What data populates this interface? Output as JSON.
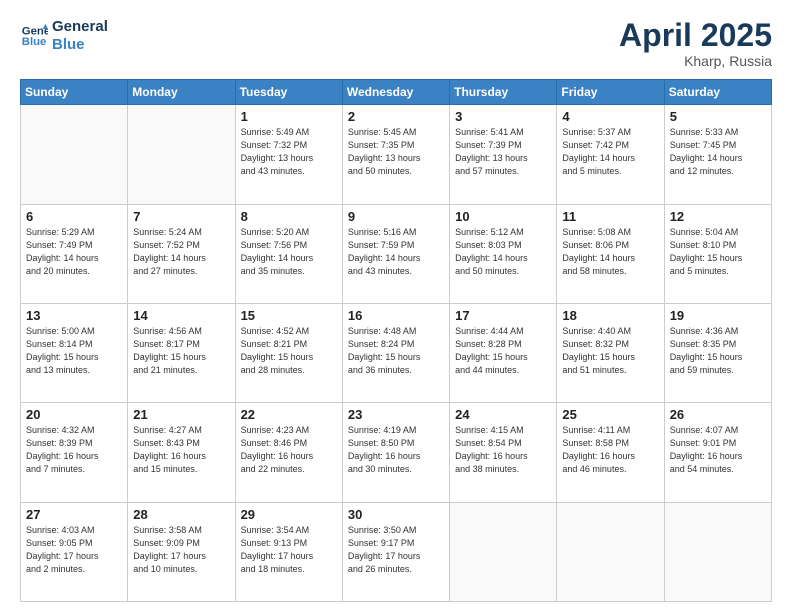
{
  "header": {
    "logo_line1": "General",
    "logo_line2": "Blue",
    "month": "April 2025",
    "location": "Kharp, Russia"
  },
  "weekdays": [
    "Sunday",
    "Monday",
    "Tuesday",
    "Wednesday",
    "Thursday",
    "Friday",
    "Saturday"
  ],
  "weeks": [
    [
      {
        "day": "",
        "info": ""
      },
      {
        "day": "",
        "info": ""
      },
      {
        "day": "1",
        "info": "Sunrise: 5:49 AM\nSunset: 7:32 PM\nDaylight: 13 hours\nand 43 minutes."
      },
      {
        "day": "2",
        "info": "Sunrise: 5:45 AM\nSunset: 7:35 PM\nDaylight: 13 hours\nand 50 minutes."
      },
      {
        "day": "3",
        "info": "Sunrise: 5:41 AM\nSunset: 7:39 PM\nDaylight: 13 hours\nand 57 minutes."
      },
      {
        "day": "4",
        "info": "Sunrise: 5:37 AM\nSunset: 7:42 PM\nDaylight: 14 hours\nand 5 minutes."
      },
      {
        "day": "5",
        "info": "Sunrise: 5:33 AM\nSunset: 7:45 PM\nDaylight: 14 hours\nand 12 minutes."
      }
    ],
    [
      {
        "day": "6",
        "info": "Sunrise: 5:29 AM\nSunset: 7:49 PM\nDaylight: 14 hours\nand 20 minutes."
      },
      {
        "day": "7",
        "info": "Sunrise: 5:24 AM\nSunset: 7:52 PM\nDaylight: 14 hours\nand 27 minutes."
      },
      {
        "day": "8",
        "info": "Sunrise: 5:20 AM\nSunset: 7:56 PM\nDaylight: 14 hours\nand 35 minutes."
      },
      {
        "day": "9",
        "info": "Sunrise: 5:16 AM\nSunset: 7:59 PM\nDaylight: 14 hours\nand 43 minutes."
      },
      {
        "day": "10",
        "info": "Sunrise: 5:12 AM\nSunset: 8:03 PM\nDaylight: 14 hours\nand 50 minutes."
      },
      {
        "day": "11",
        "info": "Sunrise: 5:08 AM\nSunset: 8:06 PM\nDaylight: 14 hours\nand 58 minutes."
      },
      {
        "day": "12",
        "info": "Sunrise: 5:04 AM\nSunset: 8:10 PM\nDaylight: 15 hours\nand 5 minutes."
      }
    ],
    [
      {
        "day": "13",
        "info": "Sunrise: 5:00 AM\nSunset: 8:14 PM\nDaylight: 15 hours\nand 13 minutes."
      },
      {
        "day": "14",
        "info": "Sunrise: 4:56 AM\nSunset: 8:17 PM\nDaylight: 15 hours\nand 21 minutes."
      },
      {
        "day": "15",
        "info": "Sunrise: 4:52 AM\nSunset: 8:21 PM\nDaylight: 15 hours\nand 28 minutes."
      },
      {
        "day": "16",
        "info": "Sunrise: 4:48 AM\nSunset: 8:24 PM\nDaylight: 15 hours\nand 36 minutes."
      },
      {
        "day": "17",
        "info": "Sunrise: 4:44 AM\nSunset: 8:28 PM\nDaylight: 15 hours\nand 44 minutes."
      },
      {
        "day": "18",
        "info": "Sunrise: 4:40 AM\nSunset: 8:32 PM\nDaylight: 15 hours\nand 51 minutes."
      },
      {
        "day": "19",
        "info": "Sunrise: 4:36 AM\nSunset: 8:35 PM\nDaylight: 15 hours\nand 59 minutes."
      }
    ],
    [
      {
        "day": "20",
        "info": "Sunrise: 4:32 AM\nSunset: 8:39 PM\nDaylight: 16 hours\nand 7 minutes."
      },
      {
        "day": "21",
        "info": "Sunrise: 4:27 AM\nSunset: 8:43 PM\nDaylight: 16 hours\nand 15 minutes."
      },
      {
        "day": "22",
        "info": "Sunrise: 4:23 AM\nSunset: 8:46 PM\nDaylight: 16 hours\nand 22 minutes."
      },
      {
        "day": "23",
        "info": "Sunrise: 4:19 AM\nSunset: 8:50 PM\nDaylight: 16 hours\nand 30 minutes."
      },
      {
        "day": "24",
        "info": "Sunrise: 4:15 AM\nSunset: 8:54 PM\nDaylight: 16 hours\nand 38 minutes."
      },
      {
        "day": "25",
        "info": "Sunrise: 4:11 AM\nSunset: 8:58 PM\nDaylight: 16 hours\nand 46 minutes."
      },
      {
        "day": "26",
        "info": "Sunrise: 4:07 AM\nSunset: 9:01 PM\nDaylight: 16 hours\nand 54 minutes."
      }
    ],
    [
      {
        "day": "27",
        "info": "Sunrise: 4:03 AM\nSunset: 9:05 PM\nDaylight: 17 hours\nand 2 minutes."
      },
      {
        "day": "28",
        "info": "Sunrise: 3:58 AM\nSunset: 9:09 PM\nDaylight: 17 hours\nand 10 minutes."
      },
      {
        "day": "29",
        "info": "Sunrise: 3:54 AM\nSunset: 9:13 PM\nDaylight: 17 hours\nand 18 minutes."
      },
      {
        "day": "30",
        "info": "Sunrise: 3:50 AM\nSunset: 9:17 PM\nDaylight: 17 hours\nand 26 minutes."
      },
      {
        "day": "",
        "info": ""
      },
      {
        "day": "",
        "info": ""
      },
      {
        "day": "",
        "info": ""
      }
    ]
  ]
}
